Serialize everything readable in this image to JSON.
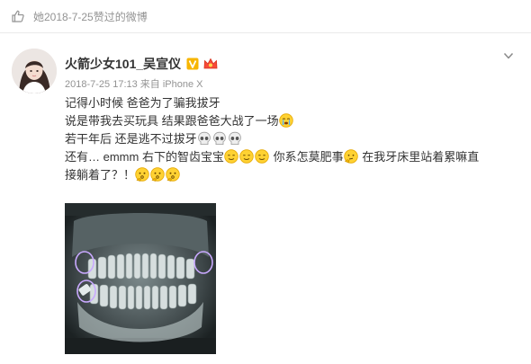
{
  "liked_bar": {
    "text": "她2018-7-25赞过的微博",
    "icon": "thumbs-up-icon"
  },
  "post": {
    "author": "火箭少女101_吴宣仪",
    "badges": [
      "verified-v-icon",
      "vip-crown-icon"
    ],
    "meta": "2018-7-25 17:13 来自 iPhone X",
    "lines": [
      {
        "text": "记得小时候 爸爸为了骗我拔牙",
        "emojis": []
      },
      {
        "text": "说是带我去买玩具 结果跟爸爸大战了一场",
        "emojis": [
          "crying-emoji-icon"
        ]
      },
      {
        "text": "若干年后 还是逃不过拔牙",
        "emojis": [
          "skull-emoji-icon",
          "skull-emoji-icon",
          "skull-emoji-icon"
        ]
      },
      {
        "text_a": "还有… emmm 右下的智齿宝宝",
        "emojis_a": [
          "awkward-smile-emoji-icon",
          "awkward-smile-emoji-icon",
          "awkward-smile-emoji-icon"
        ],
        "text_b": " 你系怎莫肥事",
        "emojis_b": [
          "thinking-emoji-icon"
        ],
        "text_c": " 在我牙床里站着累嘛直"
      },
      {
        "text": "接躺着了？！",
        "emojis": [
          "hmm-emoji-icon",
          "hmm-emoji-icon",
          "hmm-emoji-icon"
        ]
      }
    ],
    "image": {
      "icon": "dental-xray-image"
    }
  },
  "colors": {
    "muted": "#939393",
    "text": "#333333",
    "accent": "#ff8200",
    "verified": "#f7b500",
    "vip": "#f74a38"
  }
}
